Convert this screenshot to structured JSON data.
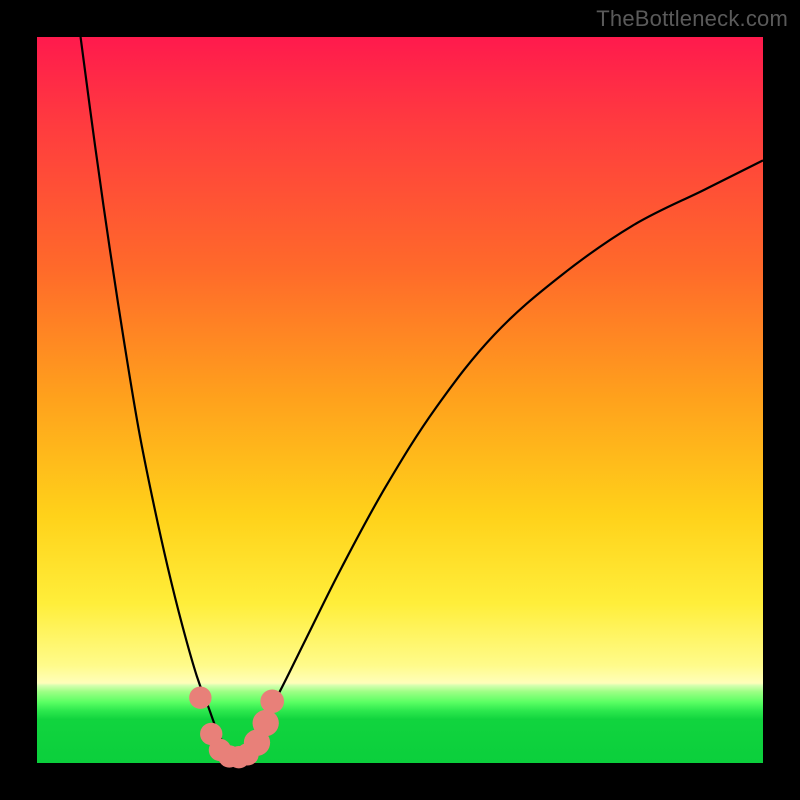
{
  "watermark": "TheBottleneck.com",
  "colors": {
    "frame": "#000000",
    "curve": "#000000",
    "marker_fill": "#e88079",
    "marker_stroke": "#c95b55",
    "gradient_top": "#ff1a4d",
    "gradient_bottom": "#0bcf3c"
  },
  "chart_data": {
    "type": "line",
    "title": "",
    "xlabel": "",
    "ylabel": "",
    "xlim": [
      0,
      100
    ],
    "ylim": [
      0,
      100
    ],
    "note": "Two monotone curves descending to near-zero around x≈24-31 then rising; y is plotted with 0 at bottom. Values are visual estimates (percent of plot area).",
    "series": [
      {
        "name": "left-branch",
        "x": [
          6,
          8,
          10,
          12,
          14,
          16,
          18,
          20,
          22,
          23.5,
          25,
          26.5
        ],
        "y": [
          100,
          85,
          71,
          58,
          46,
          36,
          27,
          19,
          12,
          8,
          4,
          1.5
        ]
      },
      {
        "name": "right-branch",
        "x": [
          28,
          30,
          33,
          37,
          42,
          48,
          55,
          63,
          72,
          82,
          92,
          100
        ],
        "y": [
          1.5,
          4,
          9,
          17,
          27,
          38,
          49,
          59,
          67,
          74,
          79,
          83
        ]
      }
    ],
    "markers": [
      {
        "x": 22.5,
        "y": 9.0,
        "r": 1.1
      },
      {
        "x": 24.0,
        "y": 4.0,
        "r": 1.1
      },
      {
        "x": 25.2,
        "y": 1.8,
        "r": 1.1
      },
      {
        "x": 26.5,
        "y": 0.9,
        "r": 1.1
      },
      {
        "x": 27.8,
        "y": 0.8,
        "r": 1.1
      },
      {
        "x": 29.0,
        "y": 1.2,
        "r": 1.1
      },
      {
        "x": 30.3,
        "y": 2.8,
        "r": 1.4
      },
      {
        "x": 31.5,
        "y": 5.5,
        "r": 1.4
      },
      {
        "x": 32.4,
        "y": 8.5,
        "r": 1.2
      }
    ]
  }
}
